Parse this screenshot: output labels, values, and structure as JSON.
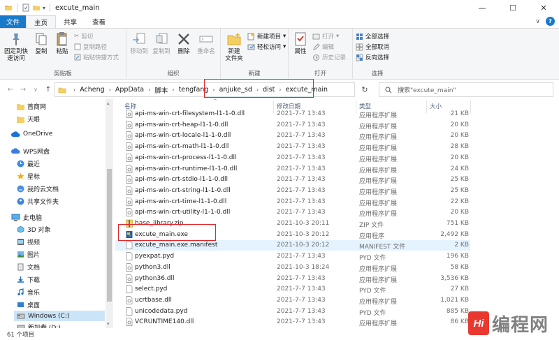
{
  "window": {
    "title": "excute_main",
    "minimize": "—",
    "maximize": "☐",
    "close": "✕"
  },
  "tabs": [
    {
      "label": "文件"
    },
    {
      "label": "主页"
    },
    {
      "label": "共享"
    },
    {
      "label": "查看"
    }
  ],
  "ribbon": {
    "clipboard": {
      "label": "剪贴板",
      "pin": "固定到快速访问",
      "pin_l1": "固定到快",
      "pin_l2": "速访问",
      "copy": "复制",
      "paste": "粘贴",
      "cut": "剪切",
      "copy_path": "复制路径",
      "paste_shortcut": "粘贴快捷方式"
    },
    "organize": {
      "label": "组织",
      "move_to": "移动到",
      "copy_to": "复制到",
      "delete": "删除",
      "rename": "重命名"
    },
    "new": {
      "label": "新建",
      "new_folder_l1": "新建",
      "new_folder_l2": "文件夹",
      "new_item": "新建项目",
      "easy_access": "轻松访问"
    },
    "open": {
      "label": "打开",
      "properties": "属性",
      "open": "打开",
      "edit": "编辑",
      "history": "历史记录"
    },
    "select": {
      "label": "选择",
      "select_all": "全部选择",
      "select_none": "全部取消",
      "invert": "反向选择"
    }
  },
  "address": {
    "crumbs": [
      "Acheng",
      "AppData",
      "脚本",
      "tengfang",
      "anjuke_sd",
      "dist",
      "excute_main"
    ],
    "search_placeholder": "搜索\"excute_main\""
  },
  "nav": [
    {
      "label": "首商网",
      "icon": "folder-icon"
    },
    {
      "label": "天眼",
      "icon": "folder-icon"
    },
    {
      "label": "OneDrive",
      "icon": "cloud-icon"
    },
    {
      "label": "WPS网盘",
      "icon": "cloud-icon"
    },
    {
      "label": "最近",
      "icon": "clock-icon"
    },
    {
      "label": "星标",
      "icon": "star-icon"
    },
    {
      "label": "我的云文档",
      "icon": "cloud-doc-icon"
    },
    {
      "label": "共享文件夹",
      "icon": "share-folder-icon"
    },
    {
      "label": "此电脑",
      "icon": "computer-icon"
    },
    {
      "label": "3D 对象",
      "icon": "cube-icon"
    },
    {
      "label": "视频",
      "icon": "video-icon"
    },
    {
      "label": "图片",
      "icon": "picture-icon"
    },
    {
      "label": "文档",
      "icon": "document-icon"
    },
    {
      "label": "下载",
      "icon": "download-icon"
    },
    {
      "label": "音乐",
      "icon": "music-icon"
    },
    {
      "label": "桌面",
      "icon": "desktop-icon"
    },
    {
      "label": "Windows (C:)",
      "icon": "drive-icon"
    },
    {
      "label": "新加卷 (D:)",
      "icon": "drive-icon"
    }
  ],
  "columns": {
    "name": "名称",
    "date": "修改日期",
    "type": "类型",
    "size": "大小"
  },
  "files": [
    {
      "name": "api-ms-win-crt-filesystem-l1-1-0.dll",
      "date": "2021-7-7 13:43",
      "type": "应用程序扩展",
      "size": "21 KB",
      "icon": "dll"
    },
    {
      "name": "api-ms-win-crt-heap-l1-1-0.dll",
      "date": "2021-7-7 13:43",
      "type": "应用程序扩展",
      "size": "20 KB",
      "icon": "dll"
    },
    {
      "name": "api-ms-win-crt-locale-l1-1-0.dll",
      "date": "2021-7-7 13:43",
      "type": "应用程序扩展",
      "size": "20 KB",
      "icon": "dll"
    },
    {
      "name": "api-ms-win-crt-math-l1-1-0.dll",
      "date": "2021-7-7 13:43",
      "type": "应用程序扩展",
      "size": "28 KB",
      "icon": "dll"
    },
    {
      "name": "api-ms-win-crt-process-l1-1-0.dll",
      "date": "2021-7-7 13:43",
      "type": "应用程序扩展",
      "size": "20 KB",
      "icon": "dll"
    },
    {
      "name": "api-ms-win-crt-runtime-l1-1-0.dll",
      "date": "2021-7-7 13:43",
      "type": "应用程序扩展",
      "size": "24 KB",
      "icon": "dll"
    },
    {
      "name": "api-ms-win-crt-stdio-l1-1-0.dll",
      "date": "2021-7-7 13:43",
      "type": "应用程序扩展",
      "size": "25 KB",
      "icon": "dll"
    },
    {
      "name": "api-ms-win-crt-string-l1-1-0.dll",
      "date": "2021-7-7 13:43",
      "type": "应用程序扩展",
      "size": "25 KB",
      "icon": "dll"
    },
    {
      "name": "api-ms-win-crt-time-l1-1-0.dll",
      "date": "2021-7-7 13:43",
      "type": "应用程序扩展",
      "size": "22 KB",
      "icon": "dll"
    },
    {
      "name": "api-ms-win-crt-utility-l1-1-0.dll",
      "date": "2021-7-7 13:43",
      "type": "应用程序扩展",
      "size": "20 KB",
      "icon": "dll"
    },
    {
      "name": "base_library.zip",
      "date": "2021-10-3 20:11",
      "type": "ZIP 文件",
      "size": "751 KB",
      "icon": "zip"
    },
    {
      "name": "excute_main.exe",
      "date": "2021-10-3 20:12",
      "type": "应用程序",
      "size": "2,492 KB",
      "icon": "exe"
    },
    {
      "name": "excute_main.exe.manifest",
      "date": "2021-10-3 20:12",
      "type": "MANIFEST 文件",
      "size": "2 KB",
      "icon": "file"
    },
    {
      "name": "pyexpat.pyd",
      "date": "2021-7-7 13:43",
      "type": "PYD 文件",
      "size": "196 KB",
      "icon": "file"
    },
    {
      "name": "python3.dll",
      "date": "2021-10-3 18:24",
      "type": "应用程序扩展",
      "size": "58 KB",
      "icon": "dll"
    },
    {
      "name": "python36.dll",
      "date": "2021-7-7 13:43",
      "type": "应用程序扩展",
      "size": "3,536 KB",
      "icon": "dll"
    },
    {
      "name": "select.pyd",
      "date": "2021-7-7 13:43",
      "type": "PYD 文件",
      "size": "27 KB",
      "icon": "file"
    },
    {
      "name": "ucrtbase.dll",
      "date": "2021-7-7 13:43",
      "type": "应用程序扩展",
      "size": "1,021 KB",
      "icon": "dll"
    },
    {
      "name": "unicodedata.pyd",
      "date": "2021-7-7 13:43",
      "type": "PYD 文件",
      "size": "885 KB",
      "icon": "file"
    },
    {
      "name": "VCRUNTIME140.dll",
      "date": "2021-7-7 13:43",
      "type": "应用程序扩展",
      "size": "86 KB",
      "icon": "dll"
    }
  ],
  "status": {
    "count": "61 个项目"
  },
  "watermark": {
    "badge": "Hi",
    "text": "编程网"
  },
  "colors": {
    "accent": "#1979ca",
    "selection": "#e5f3ff",
    "highlight_box": "#e0282b"
  }
}
